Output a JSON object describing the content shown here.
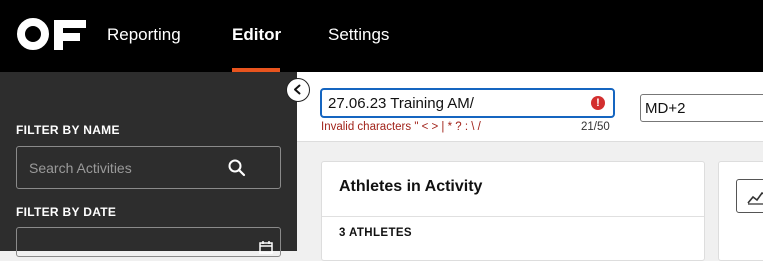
{
  "nav": {
    "logo_text": "OF",
    "items": [
      {
        "label": "Reporting",
        "active": false
      },
      {
        "label": "Editor",
        "active": true
      },
      {
        "label": "Settings",
        "active": false
      }
    ],
    "accent_color": "#e8541e"
  },
  "sidebar": {
    "filter_name_label": "FILTER BY NAME",
    "search_placeholder": "Search Activities",
    "filter_date_label": "FILTER BY DATE"
  },
  "editor": {
    "activity_name_value": "27.06.23 Training AM/",
    "error_message": "Invalid characters \" < > | * ? : \\ /",
    "char_count": "21/50",
    "md_value": "MD+2",
    "error_color": "#d32f2f",
    "focus_color": "#1565c0"
  },
  "athletes_panel": {
    "title": "Athletes in Activity",
    "count_label": "3 ATHLETES"
  },
  "icons": [
    "logo-icon",
    "search-icon",
    "calendar-icon",
    "chevron-left-icon",
    "error-icon",
    "line-chart-icon"
  ]
}
